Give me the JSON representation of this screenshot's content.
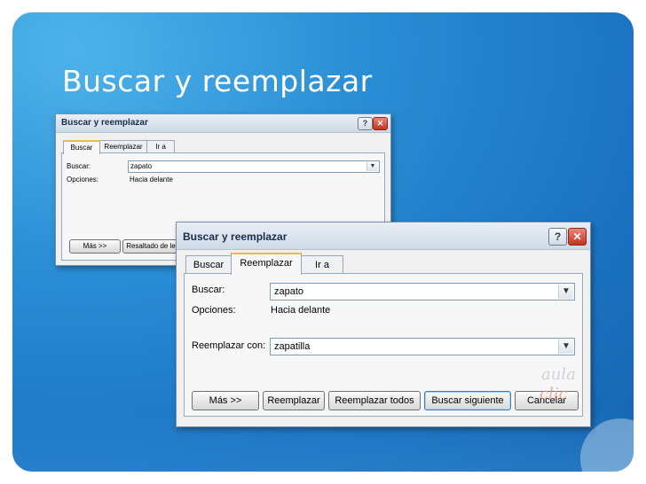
{
  "slide": {
    "title": "Buscar y reemplazar"
  },
  "dialog_small": {
    "title": "Buscar y reemplazar",
    "help_label": "?",
    "close_label": "✕",
    "tabs": [
      {
        "label": "Buscar",
        "active": true
      },
      {
        "label": "Reemplazar",
        "active": false
      },
      {
        "label": "Ir a",
        "active": false
      }
    ],
    "find_label": "Buscar:",
    "find_value": "zapato",
    "options_label": "Opciones:",
    "options_value": "Hacia delante",
    "more_button": "Más >>",
    "highlight_button": "Resaltado de lec"
  },
  "dialog_large": {
    "title": "Buscar y reemplazar",
    "help_label": "?",
    "close_label": "✕",
    "tabs": [
      {
        "label": "Buscar",
        "active": false
      },
      {
        "label": "Reemplazar",
        "active": true
      },
      {
        "label": "Ir a",
        "active": false
      }
    ],
    "find_label": "Buscar:",
    "find_value": "zapato",
    "options_label": "Opciones:",
    "options_value": "Hacia delante",
    "replace_label": "Reemplazar con:",
    "replace_value": "zapatilla",
    "buttons": {
      "more": "Más >>",
      "replace": "Reemplazar",
      "replace_all": "Reemplazar todos",
      "find_next": "Buscar siguiente",
      "cancel": "Cancelar"
    }
  },
  "watermark": {
    "line1": "aula",
    "line2": "clic"
  },
  "icons": {
    "dropdown": "chevron-down-icon",
    "help": "help-icon",
    "close": "close-icon"
  },
  "colors": {
    "slide_bg": "#2b8fd6",
    "dialog_bg": "#f0f0f0",
    "close_red": "#c2331f",
    "active_tab_accent": "#f0b848"
  }
}
